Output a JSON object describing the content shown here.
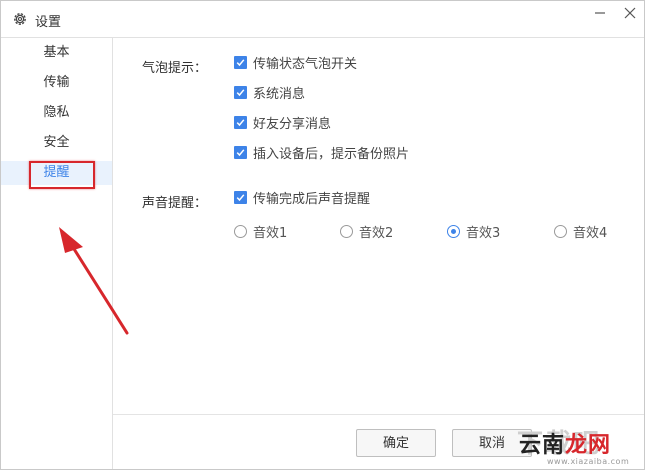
{
  "window": {
    "title": "设置",
    "icons": {
      "settings": "gear-icon",
      "minimize": "minimize-icon",
      "close": "close-icon"
    }
  },
  "sidebar": {
    "items": [
      {
        "label": "基本",
        "active": false
      },
      {
        "label": "传输",
        "active": false
      },
      {
        "label": "隐私",
        "active": false
      },
      {
        "label": "安全",
        "active": false
      },
      {
        "label": "提醒",
        "active": true
      }
    ]
  },
  "bubble": {
    "label": "气泡提示：",
    "options": [
      {
        "label": "传输状态气泡开关",
        "checked": true
      },
      {
        "label": "系统消息",
        "checked": true
      },
      {
        "label": "好友分享消息",
        "checked": true
      },
      {
        "label": "插入设备后，提示备份照片",
        "checked": true
      }
    ]
  },
  "sound": {
    "label": "声音提醒：",
    "toggle": {
      "label": "传输完成后声音提醒",
      "checked": true
    },
    "effects": [
      {
        "label": "音效1",
        "selected": false
      },
      {
        "label": "音效2",
        "selected": false
      },
      {
        "label": "音效3",
        "selected": true
      },
      {
        "label": "音效4",
        "selected": false
      }
    ]
  },
  "footer": {
    "ok_label": "确定",
    "cancel_label": "取消"
  },
  "watermark": {
    "shadow_text": "下载吧",
    "text_left": "云南",
    "text_right": "龙网",
    "url": "www.xiazaiba.com"
  },
  "colors": {
    "accent": "#3d83e8",
    "active_bg": "#e9f2fd",
    "annotation_red": "#d7272c"
  }
}
